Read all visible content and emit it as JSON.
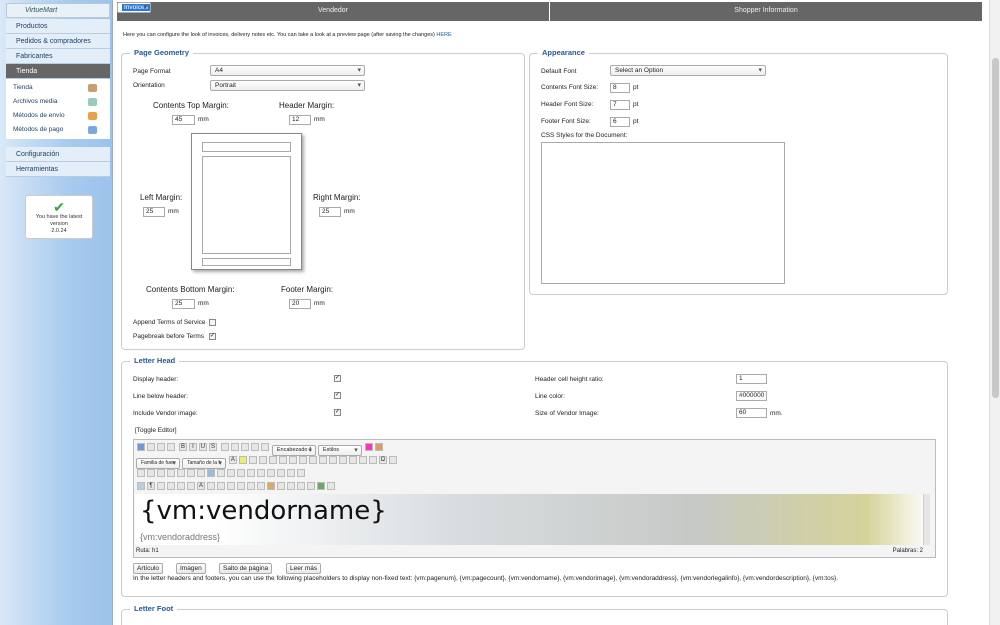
{
  "sidebar": {
    "logo": "VirtueMart",
    "menu_top": [
      "Productos",
      "Pedidos & compradores",
      "Fabricantes",
      "Tienda"
    ],
    "sub_items": [
      "Tienda",
      "Archivos media",
      "Métodos de envío",
      "Métodos de pago"
    ],
    "menu_bottom": [
      "Configuración",
      "Herramientas"
    ],
    "version_box": {
      "line1": "You have the latest",
      "line2": "version",
      "version": "2.0.24"
    }
  },
  "tabs": [
    "Vendedor",
    "Invoices",
    "Shopper Information"
  ],
  "intro": {
    "text": "Here you can configure the look of invoices, delivery notes etc. You can take a look at a preview page (after saving the changes) ",
    "link": "HERE"
  },
  "geometry": {
    "legend": "Page Geometry",
    "page_format_label": "Page Format",
    "page_format": "A4",
    "orientation_label": "Orientation",
    "orientation": "Portrait",
    "top_label": "Contents Top Margin:",
    "top": "45",
    "header_label": "Header Margin:",
    "header": "12",
    "left_label": "Left Margin:",
    "left": "25",
    "right_label": "Right Margin:",
    "right": "25",
    "bottom_label": "Contents Bottom Margin:",
    "bottom": "25",
    "footer_label": "Footer Margin:",
    "footer": "20",
    "unit": "mm",
    "append_tos": "Append Terms of Service",
    "pagebreak": "Pagebreak before Terms"
  },
  "appearance": {
    "legend": "Appearance",
    "default_font_label": "Default Font",
    "default_font": "Select an Option",
    "contents_size_label": "Contents Font Size:",
    "contents_size": "8",
    "header_size_label": "Header Font Size:",
    "header_size": "7",
    "footer_size_label": "Footer Font Size:",
    "footer_size": "6",
    "pt": "pt",
    "css_label": "CSS Styles for the Document:"
  },
  "letterhead": {
    "legend": "Letter Head",
    "display_header": "Display header:",
    "line_below": "Line below header:",
    "include_vendor_image": "Include Vendor image:",
    "cell_ratio_label": "Header cell height ratio:",
    "cell_ratio": "1",
    "line_color_label": "Line color:",
    "line_color": "#000000",
    "vendor_image_size_label": "Size of Vendor Image:",
    "vendor_image_size": "60",
    "mm": "mm.",
    "toggle": "[Toggle Editor]",
    "format_select": "Encabezado 1",
    "styles_select": "Estilos",
    "font_family": "Familia de fuer",
    "font_size": "Tamaño de la f",
    "editor_h1": "{vm:vendorname}",
    "editor_line2": "{vm:vendoraddress}",
    "path_label": "Ruta:",
    "path_value": "h1",
    "words": "Palabras: 2",
    "buttons": [
      "Artículo",
      "Imagen",
      "Salto de página",
      "Leer más"
    ],
    "placeholder_text": "In the letter headers and footers, you can use the following placeholders to display non-fixed text: {vm:pagenum}, {vm:pagecount}, {vm:vendorname}, {vm:vendorimage}, {vm:vendoraddress}, {vm:vendorlegalinfo}, {vm:vendordescription}, {vm:tos}."
  },
  "letterfoot": {
    "legend": "Letter Foot"
  }
}
